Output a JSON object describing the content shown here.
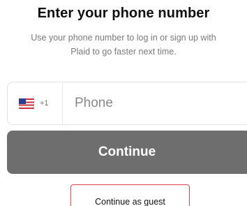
{
  "header": {
    "title": "Enter your phone number",
    "subtitle_line1": "Use your phone number to log in or sign up with",
    "subtitle_line2": "Plaid to go faster next time."
  },
  "phone_field": {
    "country_flag": "us-flag-icon",
    "dial_code": "+1",
    "placeholder": "Phone",
    "value": ""
  },
  "actions": {
    "continue_label": "Continue",
    "guest_label": "Continue as guest"
  },
  "colors": {
    "continue_bg": "#6e6e6e",
    "guest_border": "#e2424f",
    "subtitle_text": "#7a7a7a"
  }
}
